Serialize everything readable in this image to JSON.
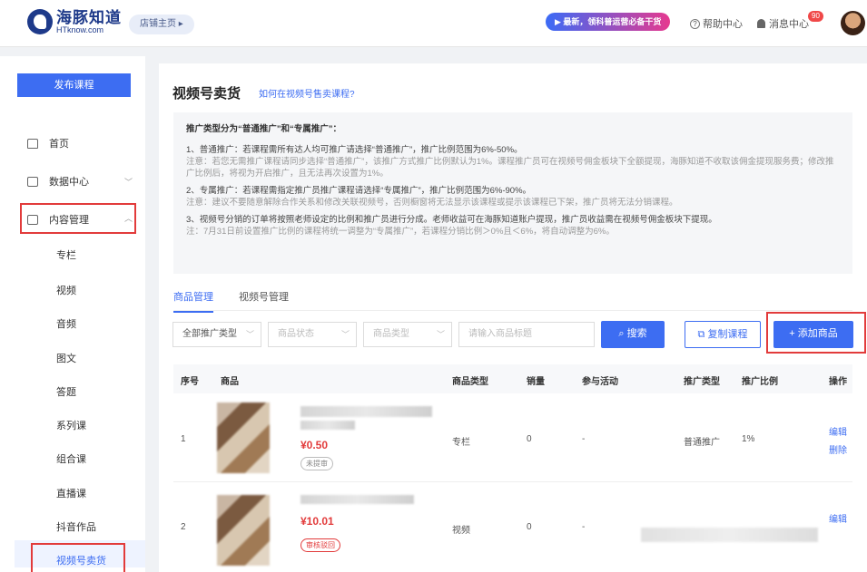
{
  "header": {
    "logo_name": "海豚知道",
    "logo_sub": "HTknow.com",
    "store_home": "店铺主页",
    "promo": "▶ 最新，领科普运营必备干货",
    "help": "帮助中心",
    "messages": "消息中心",
    "message_count": "90"
  },
  "sidebar": {
    "publish": "发布课程",
    "nav": [
      {
        "label": "首页"
      },
      {
        "label": "数据中心"
      },
      {
        "label": "内容管理"
      }
    ],
    "sub_items": [
      "专栏",
      "视频",
      "音频",
      "图文",
      "答题",
      "系列课",
      "组合课",
      "直播课",
      "抖音作品",
      "视频号卖货"
    ]
  },
  "main": {
    "title": "视频号卖货",
    "howto_link": "如何在视频号售卖课程?",
    "notice": {
      "heading": "推广类型分为“普通推广”和“专属推广”：",
      "p1": "1、普通推广：若课程需所有达人均可推广请选择“普通推广”，推广比例范围为6%-50%。",
      "p1_note": "注意：若您无需推广课程请同步选择“普通推广”，该推广方式推广比例默认为1%。课程推广员可在视频号佣金板块下全额提现，海豚知道不收取该佣金提现服务费；修改推广比例后，将视为开启推广，且无法再次设置为1%。",
      "p2": "2、专属推广：若课程需指定推广员推广课程请选择“专属推广”，推广比例范围为6%-90%。",
      "p2_note": "注意：建议不要随意解除合作关系和修改关联视频号，否则橱窗将无法显示该课程或提示该课程已下架，推广员将无法分销课程。",
      "p3": "3、视频号分销的订单将按照老师设定的比例和推广员进行分成。老师收益可在海豚知道账户提现，推广员收益需在视频号佣金板块下提现。",
      "p3_note": "注：7月31日前设置推广比例的课程将统一调整为“专属推广”，若课程分销比例＞0%且＜6%，将自动调整为6%。"
    },
    "tabs": [
      "商品管理",
      "视频号管理"
    ],
    "filters": {
      "type": "全部推广类型",
      "status": "商品状态",
      "category": "商品类型",
      "search_placeholder": "请输入商品标题",
      "search_btn": "搜索",
      "copy_btn": "复制课程",
      "add_btn": "+ 添加商品"
    },
    "table": {
      "headers": [
        "序号",
        "商品",
        "商品类型",
        "销量",
        "参与活动",
        "推广类型",
        "推广比例",
        "操作"
      ],
      "rows": [
        {
          "no": "1",
          "price": "¥0.50",
          "tag": "未提审",
          "type": "专栏",
          "sales": "0",
          "activity": "-",
          "promo_type": "普通推广",
          "ratio": "1%",
          "op1": "编辑",
          "op2": "删除"
        },
        {
          "no": "2",
          "price": "¥10.01",
          "tag": "审核驳回",
          "type": "视频",
          "sales": "0",
          "activity": "-",
          "promo_type": "",
          "ratio": "",
          "op1": "编辑",
          "op2": ""
        }
      ]
    }
  }
}
